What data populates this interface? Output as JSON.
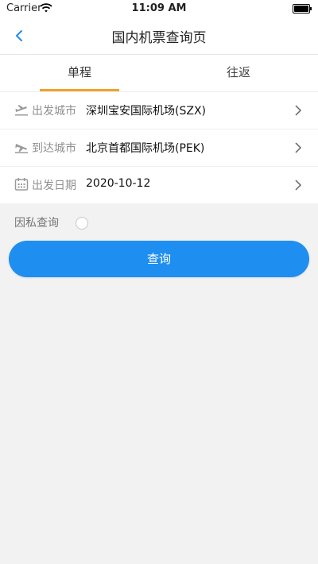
{
  "status_bar": {
    "carrier": "Carrier",
    "time": "11:09 AM"
  },
  "nav": {
    "title": "国内机票查询页",
    "back_icon": "chevron-left-icon"
  },
  "tabs": [
    {
      "label": "单程",
      "selected": true
    },
    {
      "label": "往返",
      "selected": false
    }
  ],
  "form": {
    "rows": [
      {
        "icon": "plane-departure-icon",
        "label": "出发城市",
        "value": "深圳宝安国际机场(SZX)"
      },
      {
        "icon": "plane-arrival-icon",
        "label": "到达城市",
        "value": "北京首都国际机场(PEK)"
      },
      {
        "icon": "calendar-icon",
        "label": "出发日期",
        "value": "2020-10-12"
      }
    ]
  },
  "private_query": {
    "label": "因私查询",
    "checked": false
  },
  "query_button": {
    "label": "查询"
  },
  "colors": {
    "accent": "#1f8ef1",
    "tab_underline": "#f3a12b",
    "background": "#f2f2f3"
  }
}
